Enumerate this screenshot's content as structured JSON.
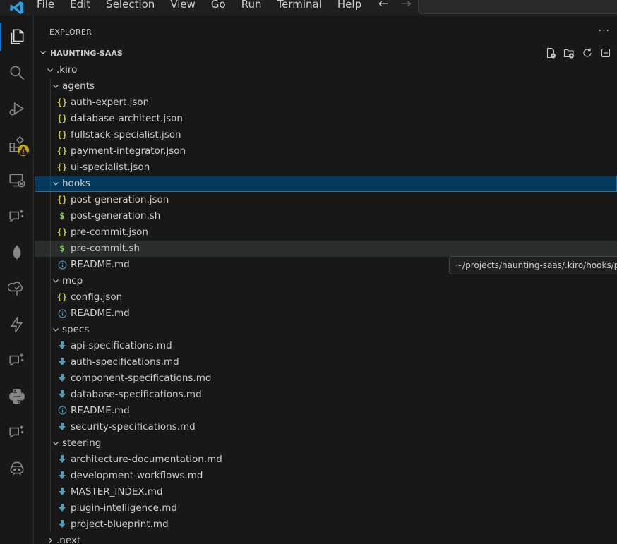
{
  "menu": [
    "File",
    "Edit",
    "Selection",
    "View",
    "Go",
    "Run",
    "Terminal",
    "Help"
  ],
  "activity_bar": [
    {
      "name": "explorer-icon",
      "active": true
    },
    {
      "name": "search-icon"
    },
    {
      "name": "run-debug-icon"
    },
    {
      "name": "extensions-icon",
      "badge": "warning"
    },
    {
      "name": "remote-explorer-icon"
    },
    {
      "name": "chat-sparkle-icon"
    },
    {
      "name": "mongodb-leaf-icon"
    },
    {
      "name": "tree-check-icon"
    },
    {
      "name": "lightning-icon"
    },
    {
      "name": "chat-sparkle-icon-2"
    },
    {
      "name": "python-icon"
    },
    {
      "name": "chat-sparkle-icon-3"
    },
    {
      "name": "copilot-icon"
    }
  ],
  "sidebar": {
    "title": "EXPLORER",
    "more": "···",
    "section": "HAUNTING-SAAS",
    "actions": [
      "new-file-icon",
      "new-folder-icon",
      "refresh-icon",
      "collapse-all-icon"
    ]
  },
  "tree": [
    {
      "label": ".kiro",
      "type": "folder",
      "open": true,
      "depth": 0
    },
    {
      "label": "agents",
      "type": "folder",
      "open": true,
      "depth": 1
    },
    {
      "label": "auth-expert.json",
      "type": "json",
      "depth": 2
    },
    {
      "label": "database-architect.json",
      "type": "json",
      "depth": 2
    },
    {
      "label": "fullstack-specialist.json",
      "type": "json",
      "depth": 2
    },
    {
      "label": "payment-integrator.json",
      "type": "json",
      "depth": 2
    },
    {
      "label": "ui-specialist.json",
      "type": "json",
      "depth": 2
    },
    {
      "label": "hooks",
      "type": "folder",
      "open": true,
      "depth": 1,
      "selected": true
    },
    {
      "label": "post-generation.json",
      "type": "json",
      "depth": 2
    },
    {
      "label": "post-generation.sh",
      "type": "sh",
      "depth": 2
    },
    {
      "label": "pre-commit.json",
      "type": "json",
      "depth": 2
    },
    {
      "label": "pre-commit.sh",
      "type": "sh",
      "depth": 2,
      "hover": true
    },
    {
      "label": "README.md",
      "type": "info",
      "depth": 2
    },
    {
      "label": "mcp",
      "type": "folder",
      "open": true,
      "depth": 1
    },
    {
      "label": "config.json",
      "type": "json",
      "depth": 2
    },
    {
      "label": "README.md",
      "type": "info",
      "depth": 2
    },
    {
      "label": "specs",
      "type": "folder",
      "open": true,
      "depth": 1
    },
    {
      "label": "api-specifications.md",
      "type": "md",
      "depth": 2
    },
    {
      "label": "auth-specifications.md",
      "type": "md",
      "depth": 2
    },
    {
      "label": "component-specifications.md",
      "type": "md",
      "depth": 2
    },
    {
      "label": "database-specifications.md",
      "type": "md",
      "depth": 2
    },
    {
      "label": "README.md",
      "type": "info",
      "depth": 2
    },
    {
      "label": "security-specifications.md",
      "type": "md",
      "depth": 2
    },
    {
      "label": "steering",
      "type": "folder",
      "open": true,
      "depth": 1
    },
    {
      "label": "architecture-documentation.md",
      "type": "md",
      "depth": 2
    },
    {
      "label": "development-workflows.md",
      "type": "md",
      "depth": 2
    },
    {
      "label": "MASTER_INDEX.md",
      "type": "md",
      "depth": 2
    },
    {
      "label": "plugin-intelligence.md",
      "type": "md",
      "depth": 2
    },
    {
      "label": "project-blueprint.md",
      "type": "md",
      "depth": 2
    },
    {
      "label": ".next",
      "type": "folder",
      "open": false,
      "depth": 0
    }
  ],
  "tooltip": "~/projects/haunting-saas/.kiro/hooks/pre",
  "colors": {
    "accent": "#0078d4",
    "selected_bg": "#04395e",
    "json": "#cbcb41",
    "sh": "#89e051",
    "md": "#519aba",
    "warning": "#cca700"
  }
}
